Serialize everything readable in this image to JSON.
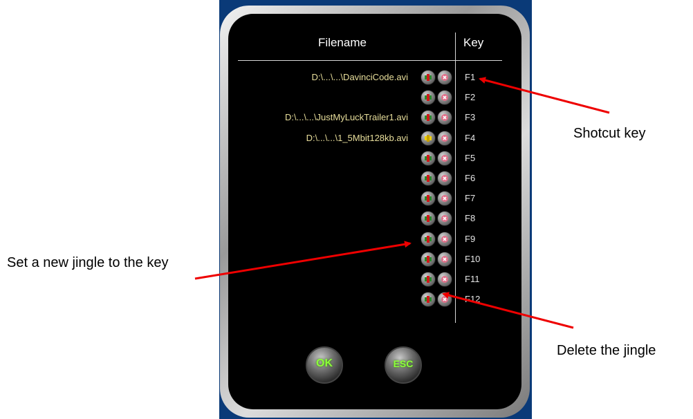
{
  "header": {
    "filename_label": "Filename",
    "key_label": "Key"
  },
  "rows": [
    {
      "file": "D:\\...\\...\\DavinciCode.avi",
      "key": "F1",
      "set_icon": "set-jingle-icon"
    },
    {
      "file": "",
      "key": "F2",
      "set_icon": "set-jingle-icon"
    },
    {
      "file": "D:\\...\\...\\JustMyLuckTrailer1.avi",
      "key": "F3",
      "set_icon": "set-jingle-icon"
    },
    {
      "file": "D:\\...\\...\\1_5Mbit128kb.avi",
      "key": "F4",
      "set_icon": "set-jingle-active-icon"
    },
    {
      "file": "",
      "key": "F5",
      "set_icon": "set-jingle-icon"
    },
    {
      "file": "",
      "key": "F6",
      "set_icon": "set-jingle-icon"
    },
    {
      "file": "",
      "key": "F7",
      "set_icon": "set-jingle-icon"
    },
    {
      "file": "",
      "key": "F8",
      "set_icon": "set-jingle-icon"
    },
    {
      "file": "",
      "key": "F9",
      "set_icon": "set-jingle-icon"
    },
    {
      "file": "",
      "key": "F10",
      "set_icon": "set-jingle-icon"
    },
    {
      "file": "",
      "key": "F11",
      "set_icon": "set-jingle-icon"
    },
    {
      "file": "",
      "key": "F12",
      "set_icon": "set-jingle-icon"
    }
  ],
  "buttons": {
    "ok_label": "OK",
    "esc_label": "ESC"
  },
  "annotations": {
    "shortcut": "Shotcut key",
    "set_jingle": "Set a new jingle to the key",
    "delete_jingle": "Delete the jingle"
  },
  "colors": {
    "screen": "#000000",
    "filename_text": "#e9df9c",
    "key_text": "#e6e6e6",
    "button_label": "#8cff3a",
    "arrow": "#ee0000",
    "backdrop": "#0a3a78"
  }
}
